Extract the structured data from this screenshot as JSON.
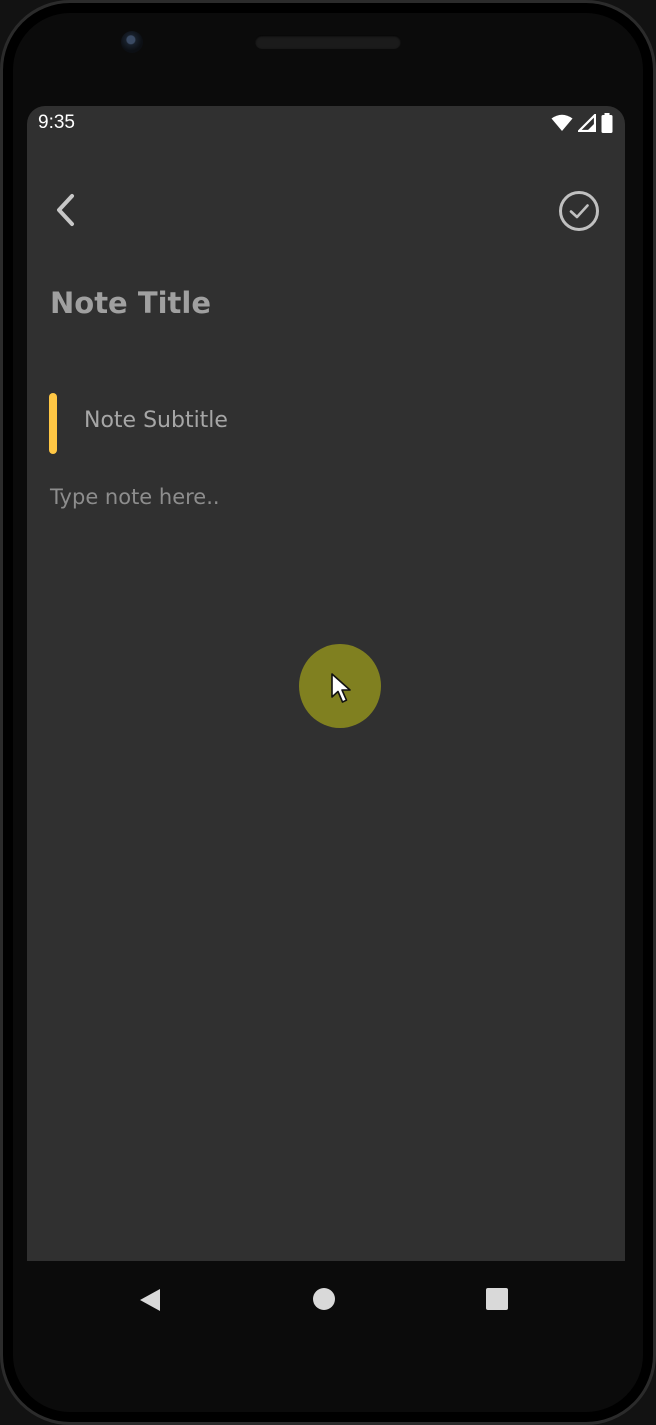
{
  "status_bar": {
    "time": "9:35",
    "icons": [
      "wifi-icon",
      "cellular-signal-icon",
      "battery-icon"
    ]
  },
  "toolbar": {
    "back_icon": "chevron-left-icon",
    "save_icon": "check-circle-icon"
  },
  "note": {
    "title_placeholder": "Note Title",
    "subtitle_placeholder": "Note Subtitle",
    "body_placeholder": "Type note here..",
    "indicator_color": "#ffc744"
  },
  "navigation": {
    "buttons": [
      "back-triangle-icon",
      "home-circle-icon",
      "recents-square-icon"
    ]
  },
  "colors": {
    "background": "#303030",
    "accent": "#ffc744",
    "text_muted": "#a0a0a0"
  }
}
